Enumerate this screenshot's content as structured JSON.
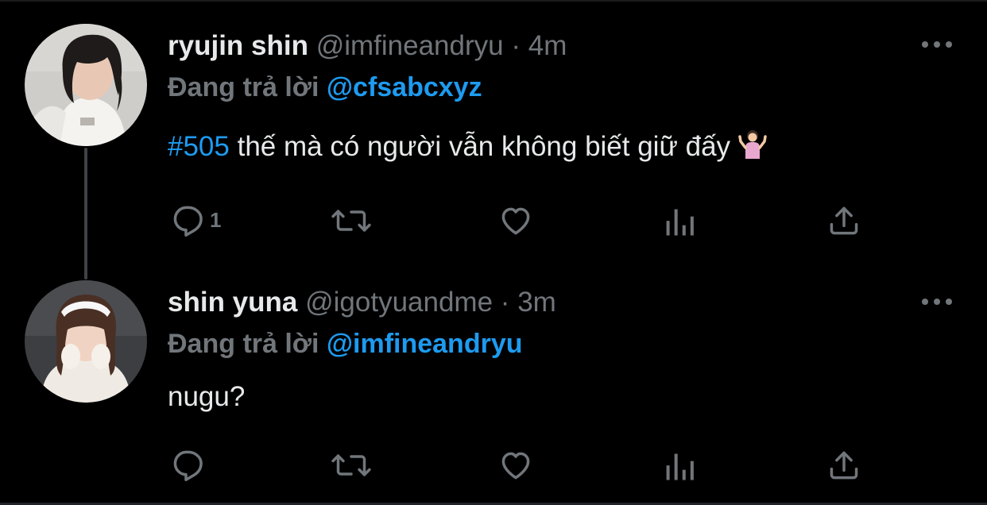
{
  "tweets": [
    {
      "display_name": "ryujin shin",
      "handle": "@imfineandryu",
      "separator": "·",
      "time": "4m",
      "reply_prefix": "Đang trả lời",
      "reply_to": "@cfsabcxyz",
      "hashtag": "#505",
      "text": " thế mà có người vẫn không biết giữ đấy ",
      "emoji": "person-shrugging-emoji",
      "reply_count": "1",
      "avatar": "girl-in-white-tshirt-photo"
    },
    {
      "display_name": "shin yuna",
      "handle": "@igotyuandme",
      "separator": "·",
      "time": "3m",
      "reply_prefix": "Đang trả lời",
      "reply_to": "@imfineandryu",
      "text": "nugu?",
      "reply_count": "",
      "avatar": "girl-with-white-headband-photo"
    }
  ],
  "icons": {
    "more": "more-horizontal-icon",
    "reply": "reply-bubble-icon",
    "retweet": "retweet-icon",
    "like": "heart-icon",
    "views": "analytics-bars-icon",
    "share": "share-upload-icon"
  },
  "colors": {
    "background": "#000000",
    "text": "#e7e9ea",
    "muted": "#71767b",
    "accent": "#1d9bf0",
    "thread_line": "#3f4347"
  }
}
